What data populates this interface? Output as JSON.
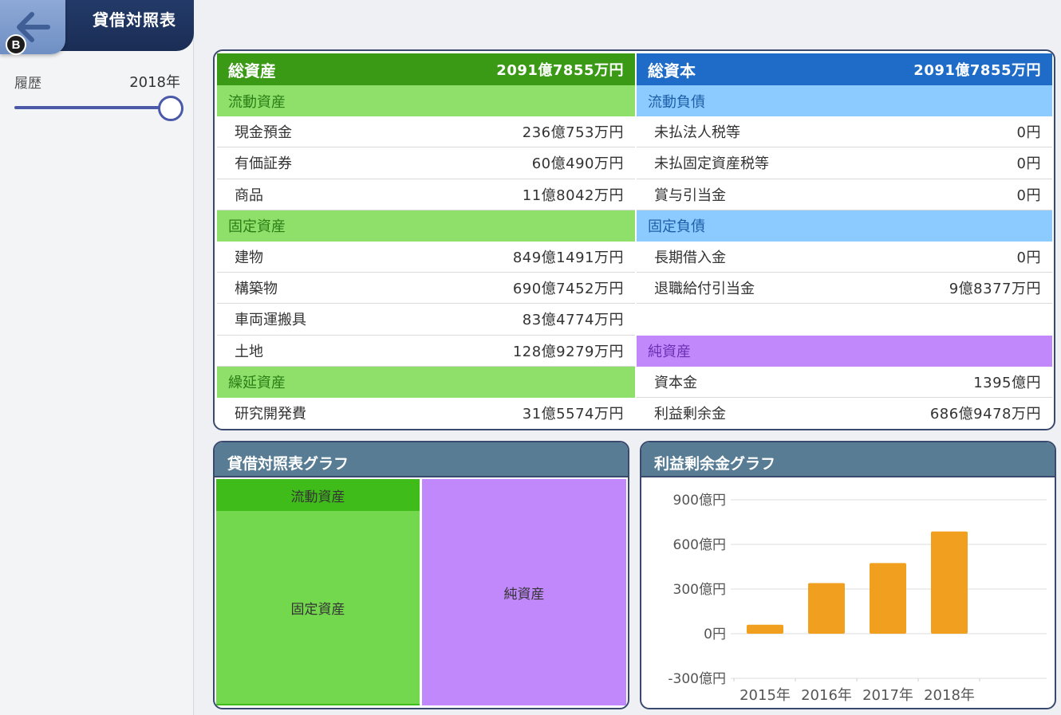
{
  "header": {
    "title": "貸借対照表",
    "badge": "B"
  },
  "sidebar": {
    "history_label": "履歴",
    "year": "2018年",
    "slider_position": 1.0
  },
  "assets": {
    "title": "総資産",
    "total": "2091億7855万円",
    "sections": [
      {
        "label": "流動資産",
        "items": [
          {
            "label": "現金預金",
            "value": "236億753万円"
          },
          {
            "label": "有価証券",
            "value": "60億490万円"
          },
          {
            "label": "商品",
            "value": "11億8042万円"
          }
        ]
      },
      {
        "label": "固定資産",
        "items": [
          {
            "label": "建物",
            "value": "849億1491万円"
          },
          {
            "label": "構築物",
            "value": "690億7452万円"
          },
          {
            "label": "車両運搬具",
            "value": "83億4774万円"
          },
          {
            "label": "土地",
            "value": "128億9279万円"
          }
        ]
      },
      {
        "label": "繰延資産",
        "items": [
          {
            "label": "研究開発費",
            "value": "31億5574万円"
          }
        ]
      }
    ]
  },
  "capital": {
    "title": "総資本",
    "total": "2091億7855万円",
    "sections": [
      {
        "label": "流動負債",
        "items": [
          {
            "label": "未払法人税等",
            "value": "0円"
          },
          {
            "label": "未払固定資産税等",
            "value": "0円"
          },
          {
            "label": "賞与引当金",
            "value": "0円"
          }
        ]
      },
      {
        "label": "固定負債",
        "items": [
          {
            "label": "長期借入金",
            "value": "0円"
          },
          {
            "label": "退職給付引当金",
            "value": "9億8377万円"
          }
        ]
      },
      {
        "label": "純資産",
        "items": [
          {
            "label": "資本金",
            "value": "1395億円"
          },
          {
            "label": "利益剰余金",
            "value": "686億9478万円"
          }
        ]
      }
    ]
  },
  "bs_graph": {
    "title": "貸借対照表グラフ",
    "blocks": {
      "current_assets": "流動資産",
      "fixed_assets": "固定資産",
      "net_assets": "純資産"
    }
  },
  "retained_graph": {
    "title": "利益剰余金グラフ"
  },
  "colors": {
    "assets_header": "#3a9a16",
    "capital_header": "#1f6cc8",
    "assets_section": "#8ee06a",
    "liabilities_section": "#8ccbff",
    "net_assets_section": "#c088fb",
    "bar": "#f0a01e",
    "graph_header": "#577c93"
  },
  "chart_data": {
    "type": "bar",
    "title": "利益剰余金グラフ",
    "categories": [
      "2015年",
      "2016年",
      "2017年",
      "2018年"
    ],
    "values": [
      60,
      340,
      475,
      687
    ],
    "ylim": [
      -300,
      900
    ],
    "yticks": [
      -300,
      0,
      300,
      600,
      900
    ],
    "ytick_labels": [
      "-300億円",
      "0円",
      "300億円",
      "600億円",
      "900億円"
    ],
    "grid": true,
    "unit": "億円"
  }
}
